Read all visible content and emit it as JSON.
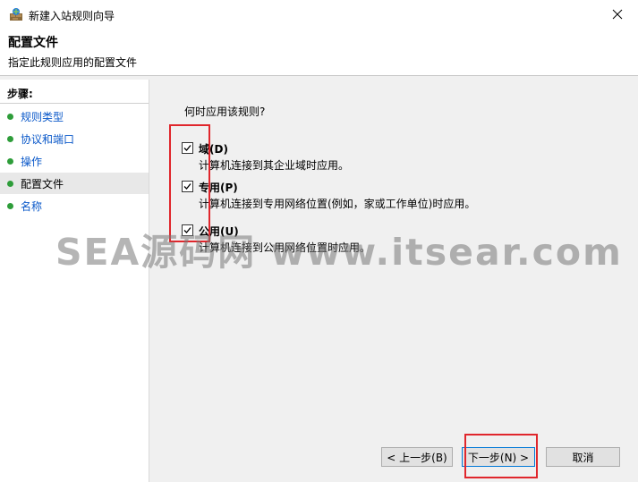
{
  "window": {
    "title": "新建入站规则向导"
  },
  "header": {
    "title": "配置文件",
    "subtitle": "指定此规则应用的配置文件"
  },
  "steps": {
    "heading": "步骤:",
    "items": [
      {
        "label": "规则类型"
      },
      {
        "label": "协议和端口"
      },
      {
        "label": "操作"
      },
      {
        "label": "配置文件"
      },
      {
        "label": "名称"
      }
    ]
  },
  "content": {
    "question": "何时应用该规则?",
    "options": [
      {
        "label": "域(D)",
        "desc": "计算机连接到其企业域时应用。",
        "checked": true
      },
      {
        "label": "专用(P)",
        "desc": "计算机连接到专用网络位置(例如，家或工作单位)时应用。",
        "checked": true
      },
      {
        "label": "公用(U)",
        "desc": "计算机连接到公用网络位置时应用。",
        "checked": true
      }
    ]
  },
  "buttons": {
    "back": "< 上一步(B)",
    "next": "下一步(N) >",
    "cancel": "取消"
  },
  "watermark": "SEA源码网 www.itsear.com",
  "colors": {
    "accent": "#0078d7",
    "step_dot": "#2e9d3a",
    "link": "#0a58c9",
    "highlight": "#e0262c"
  }
}
